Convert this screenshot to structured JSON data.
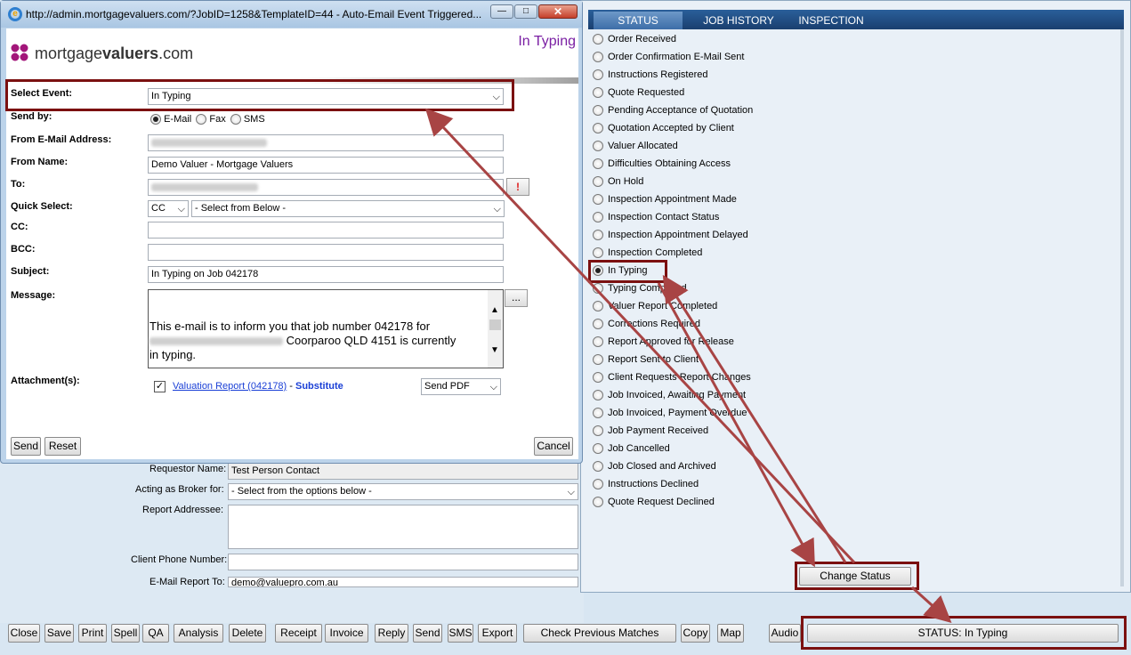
{
  "popup": {
    "url_title": "http://admin.mortgagevaluers.com/?JobID=1258&TemplateID=44 - Auto-Email Event Triggered...",
    "logo_text_a": "mortgage",
    "logo_text_b": "valuers",
    "logo_text_c": ".com",
    "header_event": "In Typing",
    "labels": {
      "select_event": "Select Event:",
      "send_by": "Send by:",
      "from_email": "From E-Mail Address:",
      "from_name": "From Name:",
      "to": "To:",
      "quick_select": "Quick Select:",
      "cc": "CC:",
      "bcc": "BCC:",
      "subject": "Subject:",
      "message": "Message:",
      "attachments": "Attachment(s):"
    },
    "select_event_value": "In Typing",
    "send_options": [
      "E-Mail",
      "Fax",
      "SMS"
    ],
    "from_name_value": "Demo Valuer - Mortgage Valuers",
    "to_alert": "!",
    "quick_select_type": "CC",
    "quick_select_value": "- Select from Below -",
    "subject_value": "In Typing on Job 042178",
    "message_line1": "This e-mail is to inform you that job number 042178 for",
    "message_line2": "Coorparoo QLD 4151 is currently",
    "message_line3": "in typing.",
    "ellipsis": "...",
    "attachment_link": "Valuation Report (042178)",
    "attachment_dash": " - ",
    "attachment_sub": "Substitute",
    "send_pdf": "Send PDF",
    "send_label": "Send",
    "reset_label": "Reset",
    "cancel_label": "Cancel"
  },
  "status_panel": {
    "tabs": [
      "STATUS",
      "JOB HISTORY",
      "INSPECTION"
    ],
    "items": [
      "Order Received",
      "Order Confirmation E-Mail Sent",
      "Instructions Registered",
      "Quote Requested",
      "Pending Acceptance of Quotation",
      "Quotation Accepted by Client",
      "Valuer Allocated",
      "Difficulties Obtaining Access",
      "On Hold",
      "Inspection Appointment Made",
      "Inspection Contact Status",
      "Inspection Appointment Delayed",
      "Inspection Completed",
      "In Typing",
      "Typing Completed",
      "Valuer Report Completed",
      "Corrections Required",
      "Report Approved for Release",
      "Report Sent to Client",
      "Client Requests Report Changes",
      "Job Invoiced, Awaiting Payment",
      "Job Invoiced, Payment Overdue",
      "Job Payment Received",
      "Job Cancelled",
      "Job Closed and Archived",
      "Instructions Declined",
      "Quote Request Declined"
    ],
    "selected": "In Typing",
    "change_status_label": "Change Status"
  },
  "background_form": {
    "requestor_label": "Requestor Name:",
    "requestor_value": "Test Person Contact",
    "broker_label": "Acting as Broker for:",
    "broker_value": "- Select from the options below -",
    "addressee_label": "Report Addressee:",
    "phone_label": "Client Phone Number:",
    "email_label": "E-Mail Report To:",
    "email_value": "demo@valuepro.com.au"
  },
  "toolbar": {
    "buttons": [
      "Close",
      "Save",
      "Print",
      "Spell",
      "QA",
      "Analysis",
      "Delete",
      "Receipt",
      "Invoice",
      "Reply",
      "Send",
      "SMS",
      "Export",
      "Check Previous Matches",
      "Copy",
      "Map",
      "Audio"
    ],
    "status_label": "STATUS: In Typing"
  },
  "colors": {
    "highlight": "#7b1010",
    "tab_bar": "#1f4f86",
    "header_event": "#7a1fa3",
    "link": "#1a3fd6"
  }
}
